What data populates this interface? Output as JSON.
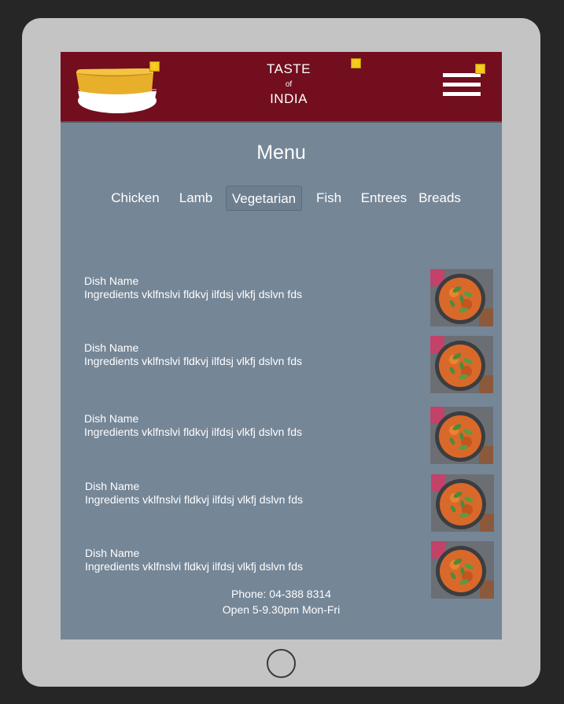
{
  "header": {
    "brand_line1": "TASTE",
    "brand_line2": "of",
    "brand_line3": "INDIA",
    "logo_icon": "food-container-icon",
    "menu_icon": "hamburger-menu-icon",
    "accent_color": "#720e1e",
    "marker_color": "#f2c81f"
  },
  "main": {
    "title": "Menu",
    "tabs": [
      {
        "label": "Chicken",
        "active": false
      },
      {
        "label": "Lamb",
        "active": false
      },
      {
        "label": "Vegetarian",
        "active": true
      },
      {
        "label": "Fish",
        "active": false
      },
      {
        "label": "Entrees",
        "active": false
      },
      {
        "label": "Breads",
        "active": false
      }
    ],
    "dishes": [
      {
        "name": "Dish Name",
        "ingredients": "Ingredients vklfnslvi fldkvj ilfdsj vlkfj dslvn fds"
      },
      {
        "name": "Dish Name",
        "ingredients": "Ingredients vklfnslvi fldkvj ilfdsj vlkfj dslvn fds"
      },
      {
        "name": "Dish Name",
        "ingredients": "Ingredients vklfnslvi fldkvj ilfdsj vlkfj dslvn fds"
      },
      {
        "name": "Dish Name",
        "ingredients": "Ingredients vklfnslvi fldkvj ilfdsj vlkfj dslvn fds"
      },
      {
        "name": "Dish Name",
        "ingredients": "Ingredients vklfnslvi fldkvj ilfdsj vlkfj dslvn fds"
      }
    ]
  },
  "footer": {
    "phone": "Phone: 04-388 8314",
    "hours": "Open 5-9.30pm Mon-Fri"
  },
  "colors": {
    "screen_bg": "#758697",
    "tablet_frame": "#c4c4c4",
    "background": "#262626"
  }
}
